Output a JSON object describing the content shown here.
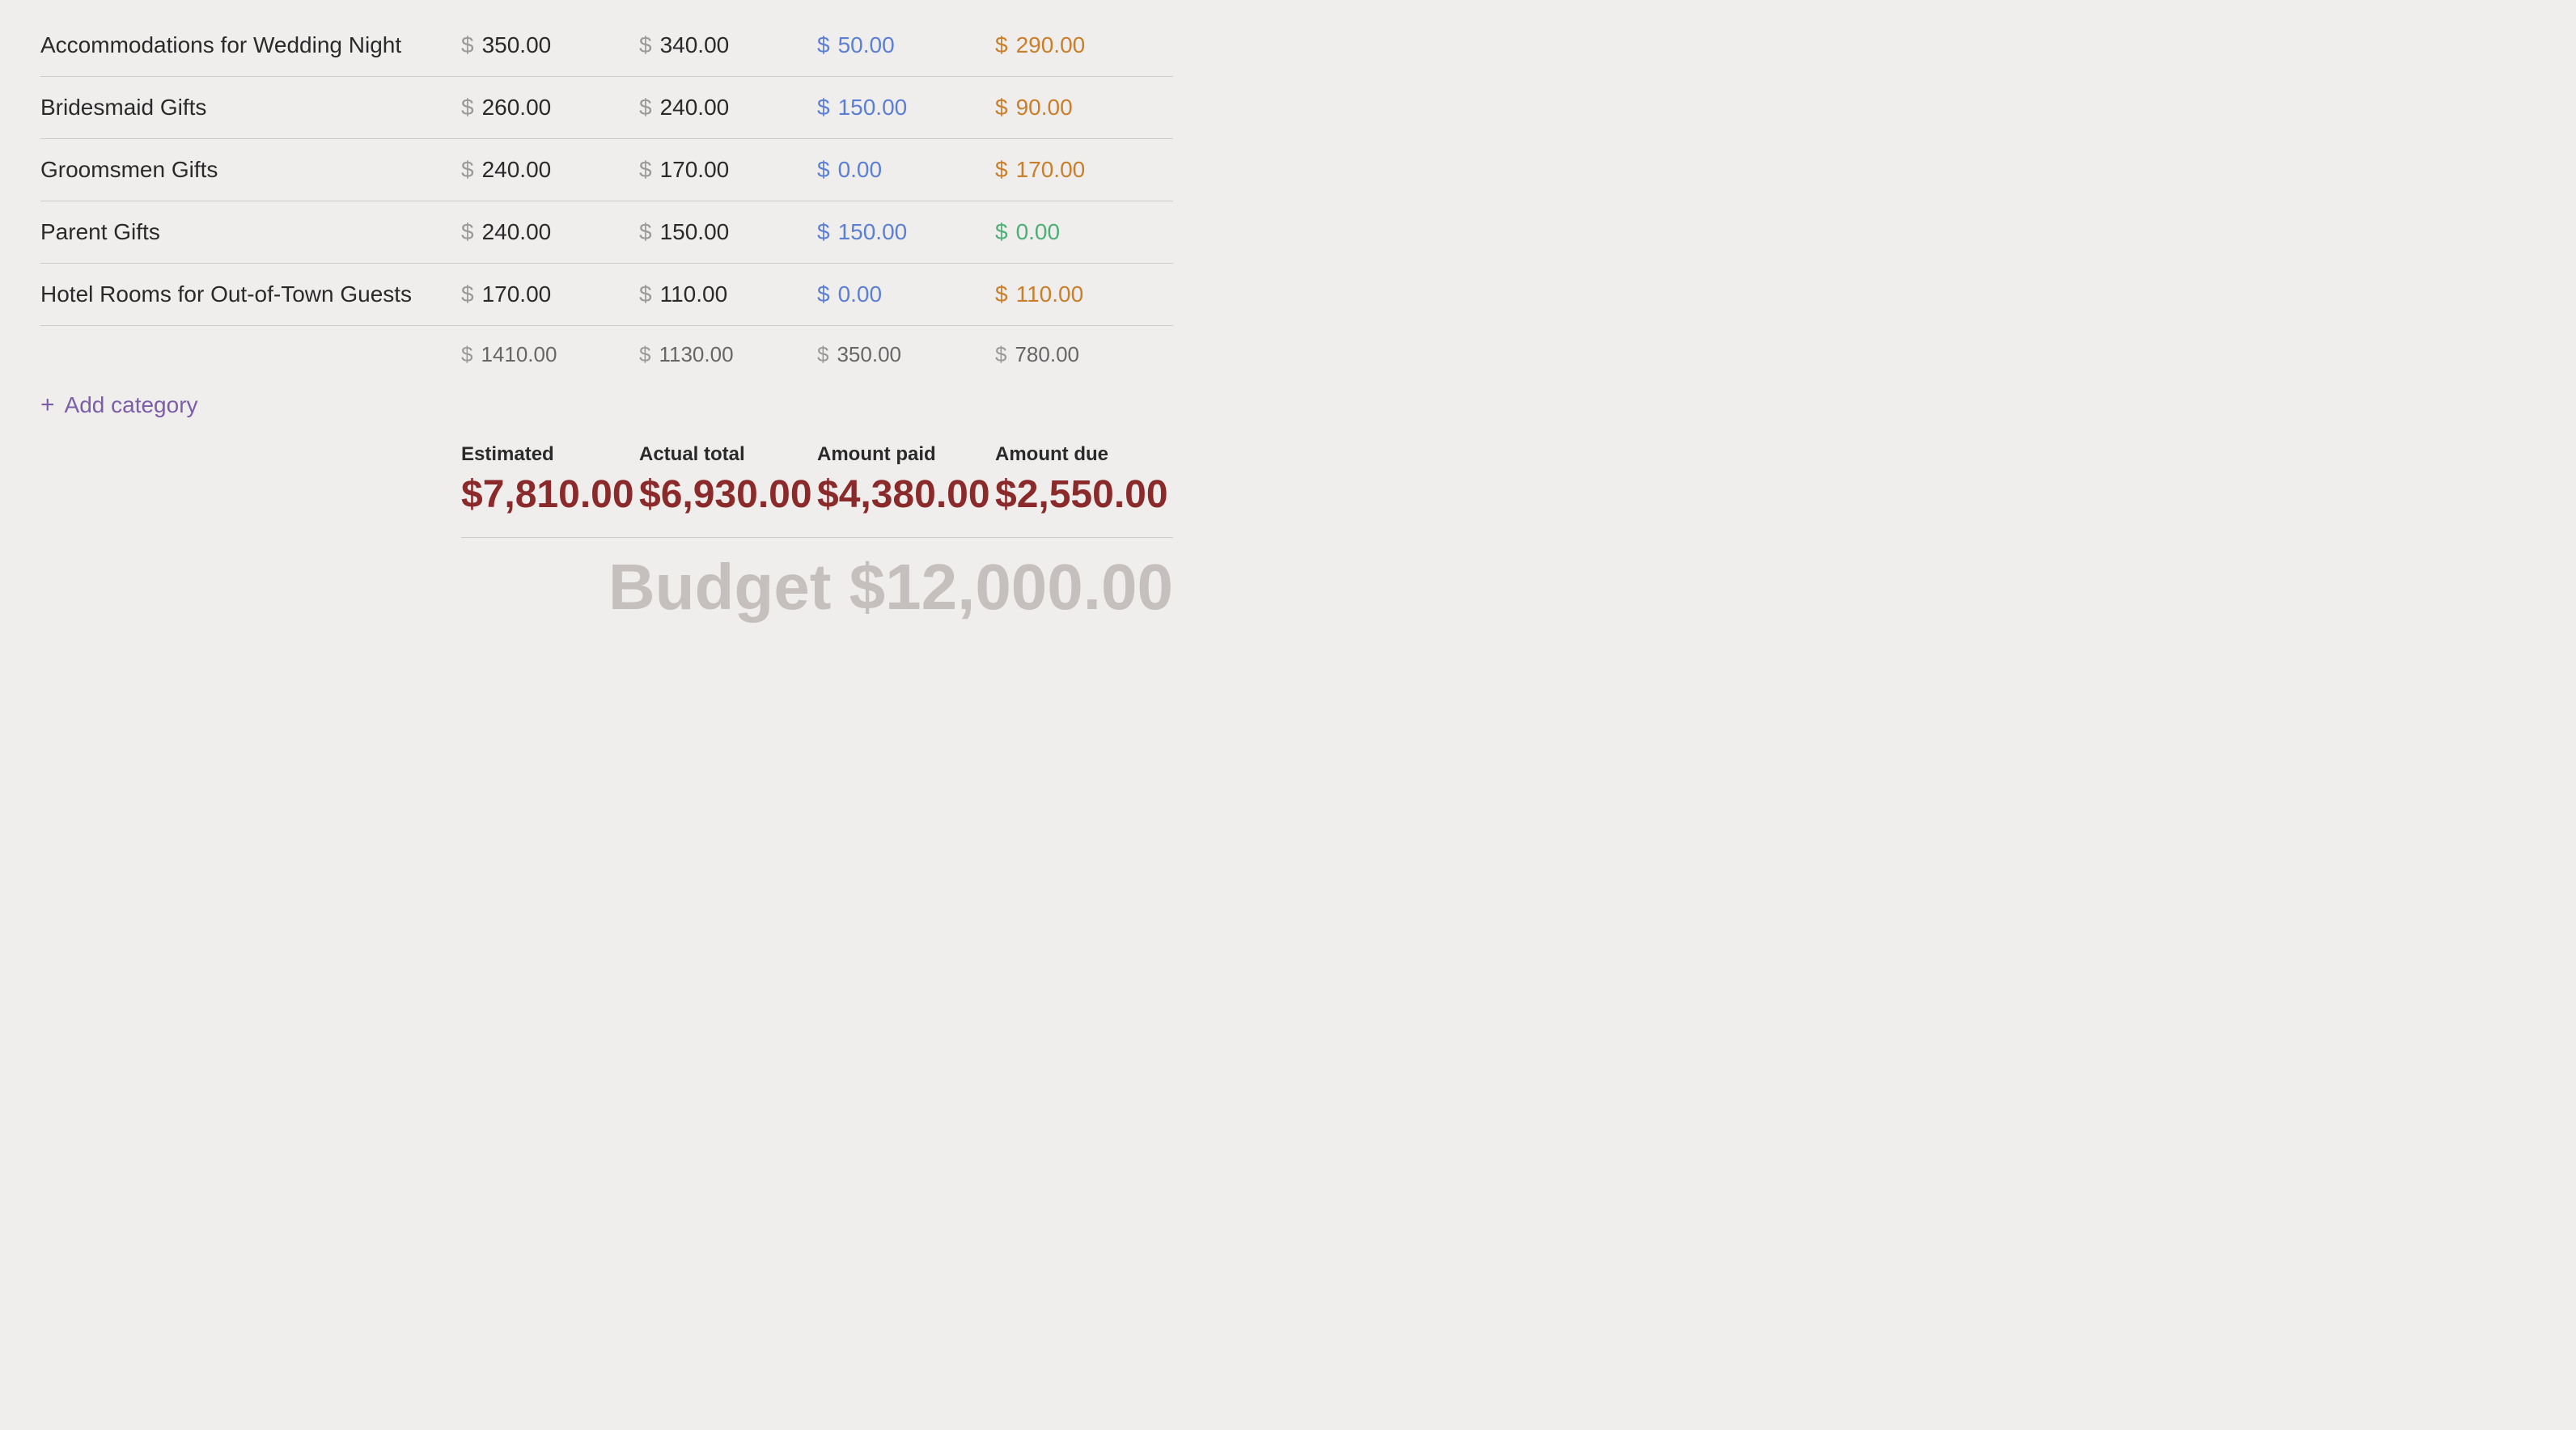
{
  "rows": [
    {
      "name": "Accommodations for Wedding Night",
      "estimated": "350.00",
      "actual": "340.00",
      "paid": "50.00",
      "due": "290.00",
      "due_color": "orange"
    },
    {
      "name": "Bridesmaid Gifts",
      "estimated": "260.00",
      "actual": "240.00",
      "paid": "150.00",
      "due": "90.00",
      "due_color": "orange"
    },
    {
      "name": "Groomsmen Gifts",
      "estimated": "240.00",
      "actual": "170.00",
      "paid": "0.00",
      "due": "170.00",
      "due_color": "orange"
    },
    {
      "name": "Parent Gifts",
      "estimated": "240.00",
      "actual": "150.00",
      "paid": "150.00",
      "due": "0.00",
      "due_color": "green"
    },
    {
      "name": "Hotel Rooms for Out-of-Town Guests",
      "estimated": "170.00",
      "actual": "110.00",
      "paid": "0.00",
      "due": "110.00",
      "due_color": "orange"
    }
  ],
  "totals": {
    "estimated": "1410.00",
    "actual": "1130.00",
    "paid": "350.00",
    "due": "780.00"
  },
  "add_category_label": "+ Add category",
  "summary": {
    "estimated_label": "Estimated",
    "estimated_value": "$7,810.00",
    "actual_label": "Actual total",
    "actual_value": "$6,930.00",
    "paid_label": "Amount paid",
    "paid_value": "$4,380.00",
    "due_label": "Amount due",
    "due_value": "$2,550.00"
  },
  "budget_label": "Budget $12,000.00",
  "dollar_sign": "$"
}
